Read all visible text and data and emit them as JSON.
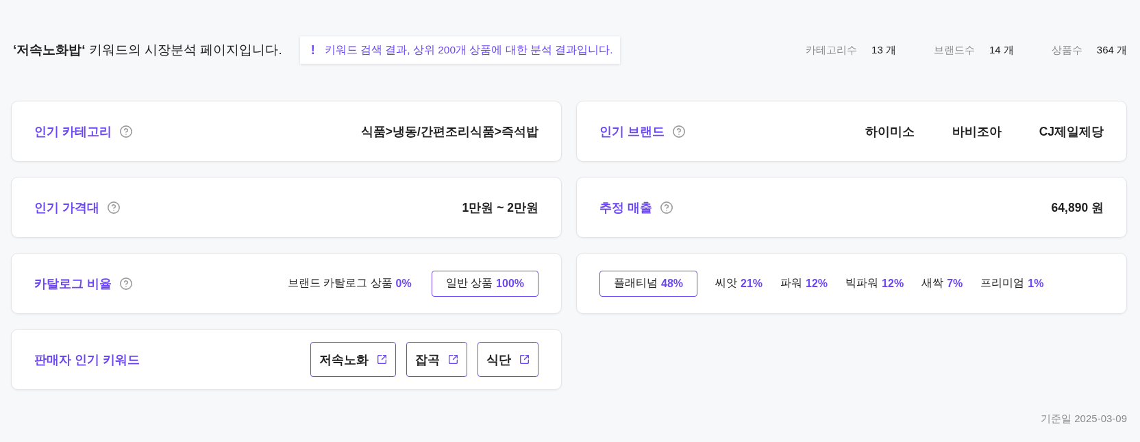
{
  "header": {
    "title": "**‘저속노화밥‘** 키워드의 시장분석 페이지입니다.",
    "notice": {
      "mark": "!",
      "text": "키워드 검색 결과, 상위 200개 상품에 대한 분석 결과입니다."
    },
    "stats": [
      {
        "label": "카테고리수",
        "value": "13 개"
      },
      {
        "label": "브랜드수",
        "value": "14 개"
      },
      {
        "label": "상품수",
        "value": "364 개"
      }
    ]
  },
  "cards": [
    {
      "kind": "value",
      "title": "인기 카테고리",
      "help": true,
      "value": "식품>냉동/간편조리식품>즉석밥"
    },
    {
      "kind": "brands",
      "title": "인기 브랜드",
      "help": true,
      "brands": [
        "하이미소",
        "바비조아",
        "CJ제일제당"
      ]
    },
    {
      "kind": "value",
      "title": "인기 가격대",
      "help": true,
      "value": "1만원 ~ 2만원"
    },
    {
      "kind": "value",
      "title": "추정 매출",
      "help": true,
      "value": "64,890 원"
    },
    {
      "kind": "ratio",
      "title": "카탈로그 비율",
      "help": true,
      "options": [
        {
          "label": "브랜드 카탈로그 상품",
          "value": "0%",
          "selected": false
        },
        {
          "label": "일반 상품",
          "value": "100%",
          "selected": true
        }
      ]
    },
    {
      "kind": "grades",
      "options": [
        {
          "label": "플래티넘",
          "value": "48%",
          "selected": true
        },
        {
          "label": "씨앗",
          "value": "21%",
          "selected": false
        },
        {
          "label": "파워",
          "value": "12%",
          "selected": false
        },
        {
          "label": "빅파워",
          "value": "12%",
          "selected": false
        },
        {
          "label": "새싹",
          "value": "7%",
          "selected": false
        },
        {
          "label": "프리미엄",
          "value": "1%",
          "selected": false
        }
      ]
    },
    {
      "kind": "keywords",
      "title": "판매자 인기 키워드",
      "help": false,
      "links": [
        "저속노화",
        "잡곡",
        "식단"
      ]
    }
  ],
  "footer": {
    "reference_date": "기준일 2025-03-09"
  }
}
